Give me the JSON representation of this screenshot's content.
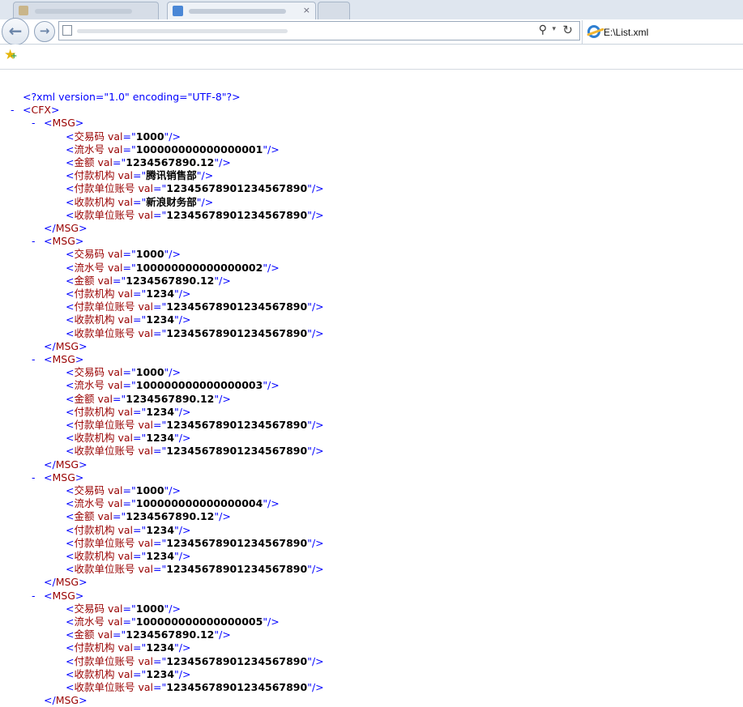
{
  "browser": {
    "tab_title": "E:\\List.xml",
    "tab_close_glyph": "×",
    "nav": {
      "back_glyph": "←",
      "forward_glyph": "→"
    },
    "address": {
      "search_glyph": "⚲",
      "dropdown_glyph": "▾",
      "refresh_glyph": "↻"
    },
    "favorites_glyph": "★",
    "favorites_plus_glyph": "+"
  },
  "xml": {
    "declaration": "<?xml version=\"1.0\" encoding=\"UTF-8\"?>",
    "collapse_glyph": "-",
    "root_open": "<CFX>",
    "msg_open": "<MSG>",
    "msg_close": "</MSG>",
    "attr_name": "val",
    "messages": [
      {
        "fields": [
          {
            "tag": "交易码",
            "value": "1000"
          },
          {
            "tag": "流水号",
            "value": "100000000000000001"
          },
          {
            "tag": "金额",
            "value": "1234567890.12"
          },
          {
            "tag": "付款机构",
            "value": "腾讯销售部"
          },
          {
            "tag": "付款单位账号",
            "value": "12345678901234567890"
          },
          {
            "tag": "收款机构",
            "value": "新浪财务部"
          },
          {
            "tag": "收款单位账号",
            "value": "12345678901234567890"
          }
        ]
      },
      {
        "fields": [
          {
            "tag": "交易码",
            "value": "1000"
          },
          {
            "tag": "流水号",
            "value": "100000000000000002"
          },
          {
            "tag": "金额",
            "value": "1234567890.12"
          },
          {
            "tag": "付款机构",
            "value": "1234"
          },
          {
            "tag": "付款单位账号",
            "value": "12345678901234567890"
          },
          {
            "tag": "收款机构",
            "value": "1234"
          },
          {
            "tag": "收款单位账号",
            "value": "12345678901234567890"
          }
        ]
      },
      {
        "fields": [
          {
            "tag": "交易码",
            "value": "1000"
          },
          {
            "tag": "流水号",
            "value": "100000000000000003"
          },
          {
            "tag": "金额",
            "value": "1234567890.12"
          },
          {
            "tag": "付款机构",
            "value": "1234"
          },
          {
            "tag": "付款单位账号",
            "value": "12345678901234567890"
          },
          {
            "tag": "收款机构",
            "value": "1234"
          },
          {
            "tag": "收款单位账号",
            "value": "12345678901234567890"
          }
        ]
      },
      {
        "fields": [
          {
            "tag": "交易码",
            "value": "1000"
          },
          {
            "tag": "流水号",
            "value": "100000000000000004"
          },
          {
            "tag": "金额",
            "value": "1234567890.12"
          },
          {
            "tag": "付款机构",
            "value": "1234"
          },
          {
            "tag": "付款单位账号",
            "value": "12345678901234567890"
          },
          {
            "tag": "收款机构",
            "value": "1234"
          },
          {
            "tag": "收款单位账号",
            "value": "12345678901234567890"
          }
        ]
      },
      {
        "fields": [
          {
            "tag": "交易码",
            "value": "1000"
          },
          {
            "tag": "流水号",
            "value": "100000000000000005"
          },
          {
            "tag": "金额",
            "value": "1234567890.12"
          },
          {
            "tag": "付款机构",
            "value": "1234"
          },
          {
            "tag": "付款单位账号",
            "value": "12345678901234567890"
          },
          {
            "tag": "收款机构",
            "value": "1234"
          },
          {
            "tag": "收款单位账号",
            "value": "12345678901234567890"
          }
        ]
      }
    ]
  }
}
